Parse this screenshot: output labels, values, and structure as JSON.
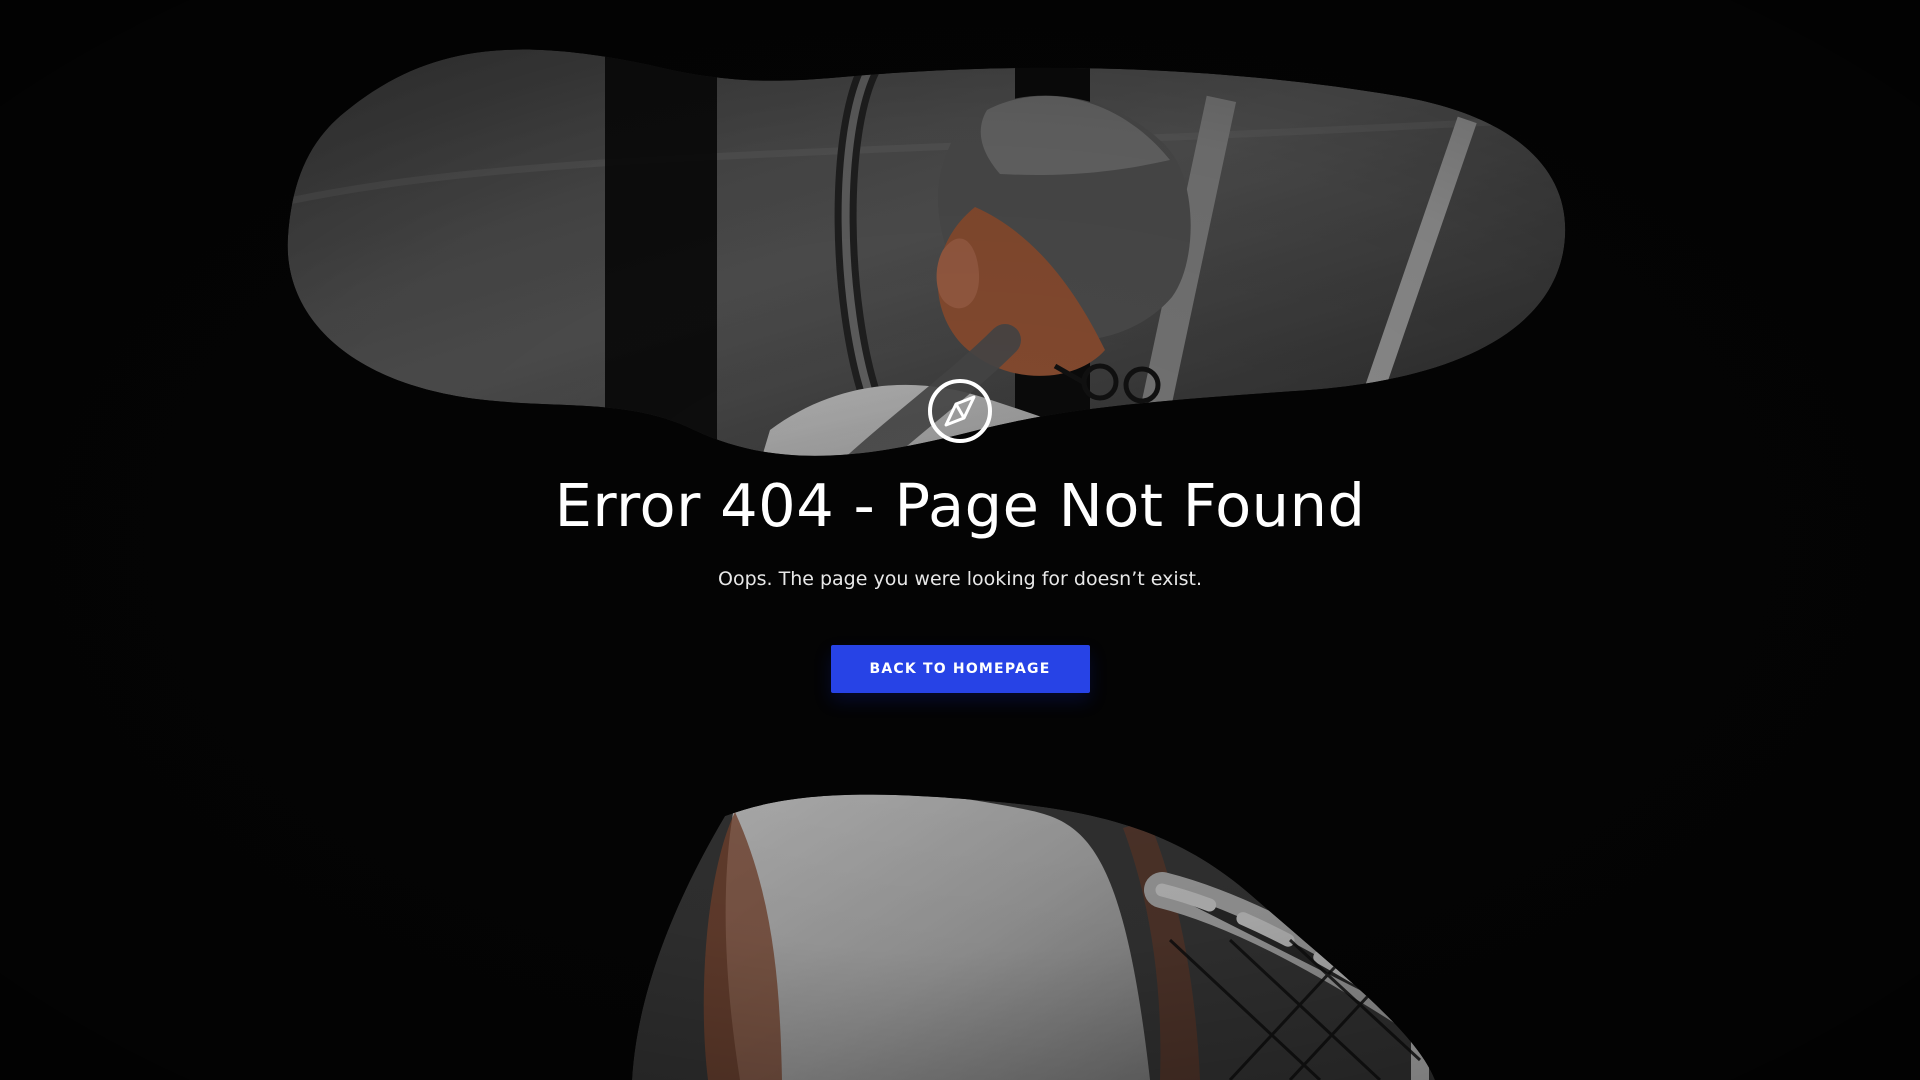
{
  "error_page": {
    "title": "Error 404 - Page Not Found",
    "message": "Oops. The page you were looking for doesn’t exist.",
    "button_label": "BACK TO HOMEPAGE",
    "icon": "compass-icon"
  },
  "colors": {
    "background": "#070707",
    "button": "#2743e6",
    "text": "#ffffff"
  }
}
